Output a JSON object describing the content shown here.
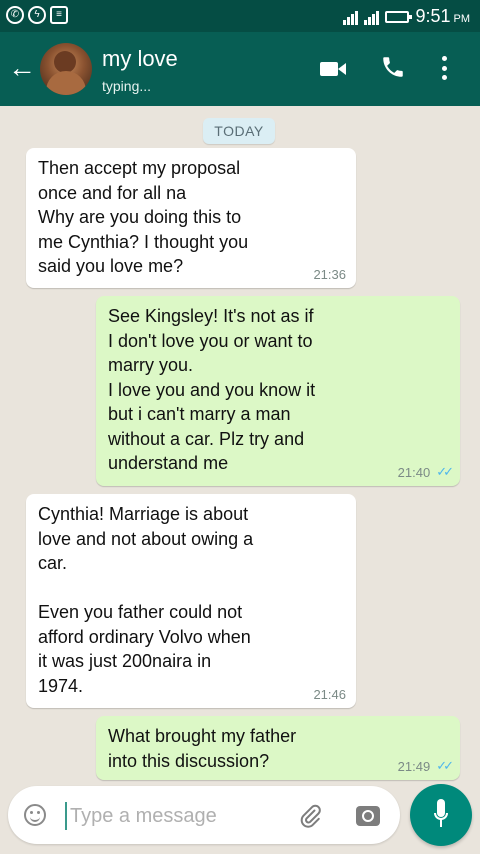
{
  "status_bar": {
    "time": "9:51",
    "am_pm": "PM",
    "icons": [
      "whatsapp-icon",
      "messenger-icon",
      "message-icon",
      "signal-icon",
      "signal-icon",
      "battery-icon"
    ]
  },
  "header": {
    "contact_name": "my love",
    "contact_status": "typing...",
    "icons": [
      "back-arrow-icon",
      "avatar",
      "video-call-icon",
      "phone-icon",
      "more-vert-icon"
    ]
  },
  "conversation": {
    "date_label": "TODAY",
    "messages": [
      {
        "direction": "incoming",
        "text": "Then accept my proposal\nonce and for all na\nWhy are you doing this to\nme Cynthia? I thought you\nsaid you love me?",
        "time": "21:36"
      },
      {
        "direction": "outgoing",
        "text": "See Kingsley!  It's not as if\nI don't love you or want to\nmarry you.\nI love you and you know it\nbut i can't marry a man\nwithout a car.  Plz try and\nunderstand me",
        "time": "21:40",
        "ticks": "✓✓"
      },
      {
        "direction": "incoming",
        "text": "Cynthia! Marriage is about\nlove and not about owing a\ncar.\n\nEven you father could not\nafford ordinary Volvo when\nit was just 200naira in\n1974.",
        "time": "21:46"
      },
      {
        "direction": "outgoing",
        "text": "What brought my father\ninto this discussion?",
        "time": "21:49",
        "ticks": "✓✓"
      }
    ]
  },
  "composer": {
    "placeholder": "Type a message",
    "value": ""
  },
  "colors": {
    "header": "#075e54",
    "status_bar": "#054d44",
    "outgoing_bubble": "#dcf8c6",
    "incoming_bubble": "#ffffff",
    "mic_button": "#00897b",
    "read_ticks": "#4fb6ec"
  }
}
